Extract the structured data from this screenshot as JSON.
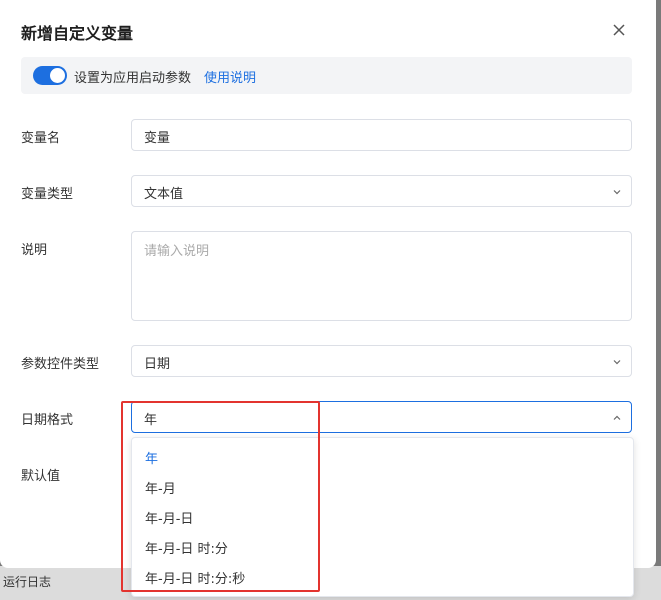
{
  "bottom_bar": {
    "label": "运行日志"
  },
  "dialog": {
    "title": "新增自定义变量",
    "banner": {
      "text": "设置为应用启动参数",
      "link": "使用说明",
      "toggle_on": true
    }
  },
  "form": {
    "name": {
      "label": "变量名",
      "value": "变量"
    },
    "type": {
      "label": "变量类型",
      "value": "文本值"
    },
    "desc": {
      "label": "说明",
      "placeholder": "请输入说明"
    },
    "control": {
      "label": "参数控件类型",
      "value": "日期"
    },
    "date_format": {
      "label": "日期格式",
      "value": "年"
    },
    "default": {
      "label": "默认值"
    }
  },
  "dropdown": {
    "options": [
      "年",
      "年-月",
      "年-月-日",
      "年-月-日 时:分",
      "年-月-日 时:分:秒"
    ],
    "selected": "年"
  },
  "colors": {
    "accent": "#1d6fe0",
    "highlight": "#e3342f"
  }
}
